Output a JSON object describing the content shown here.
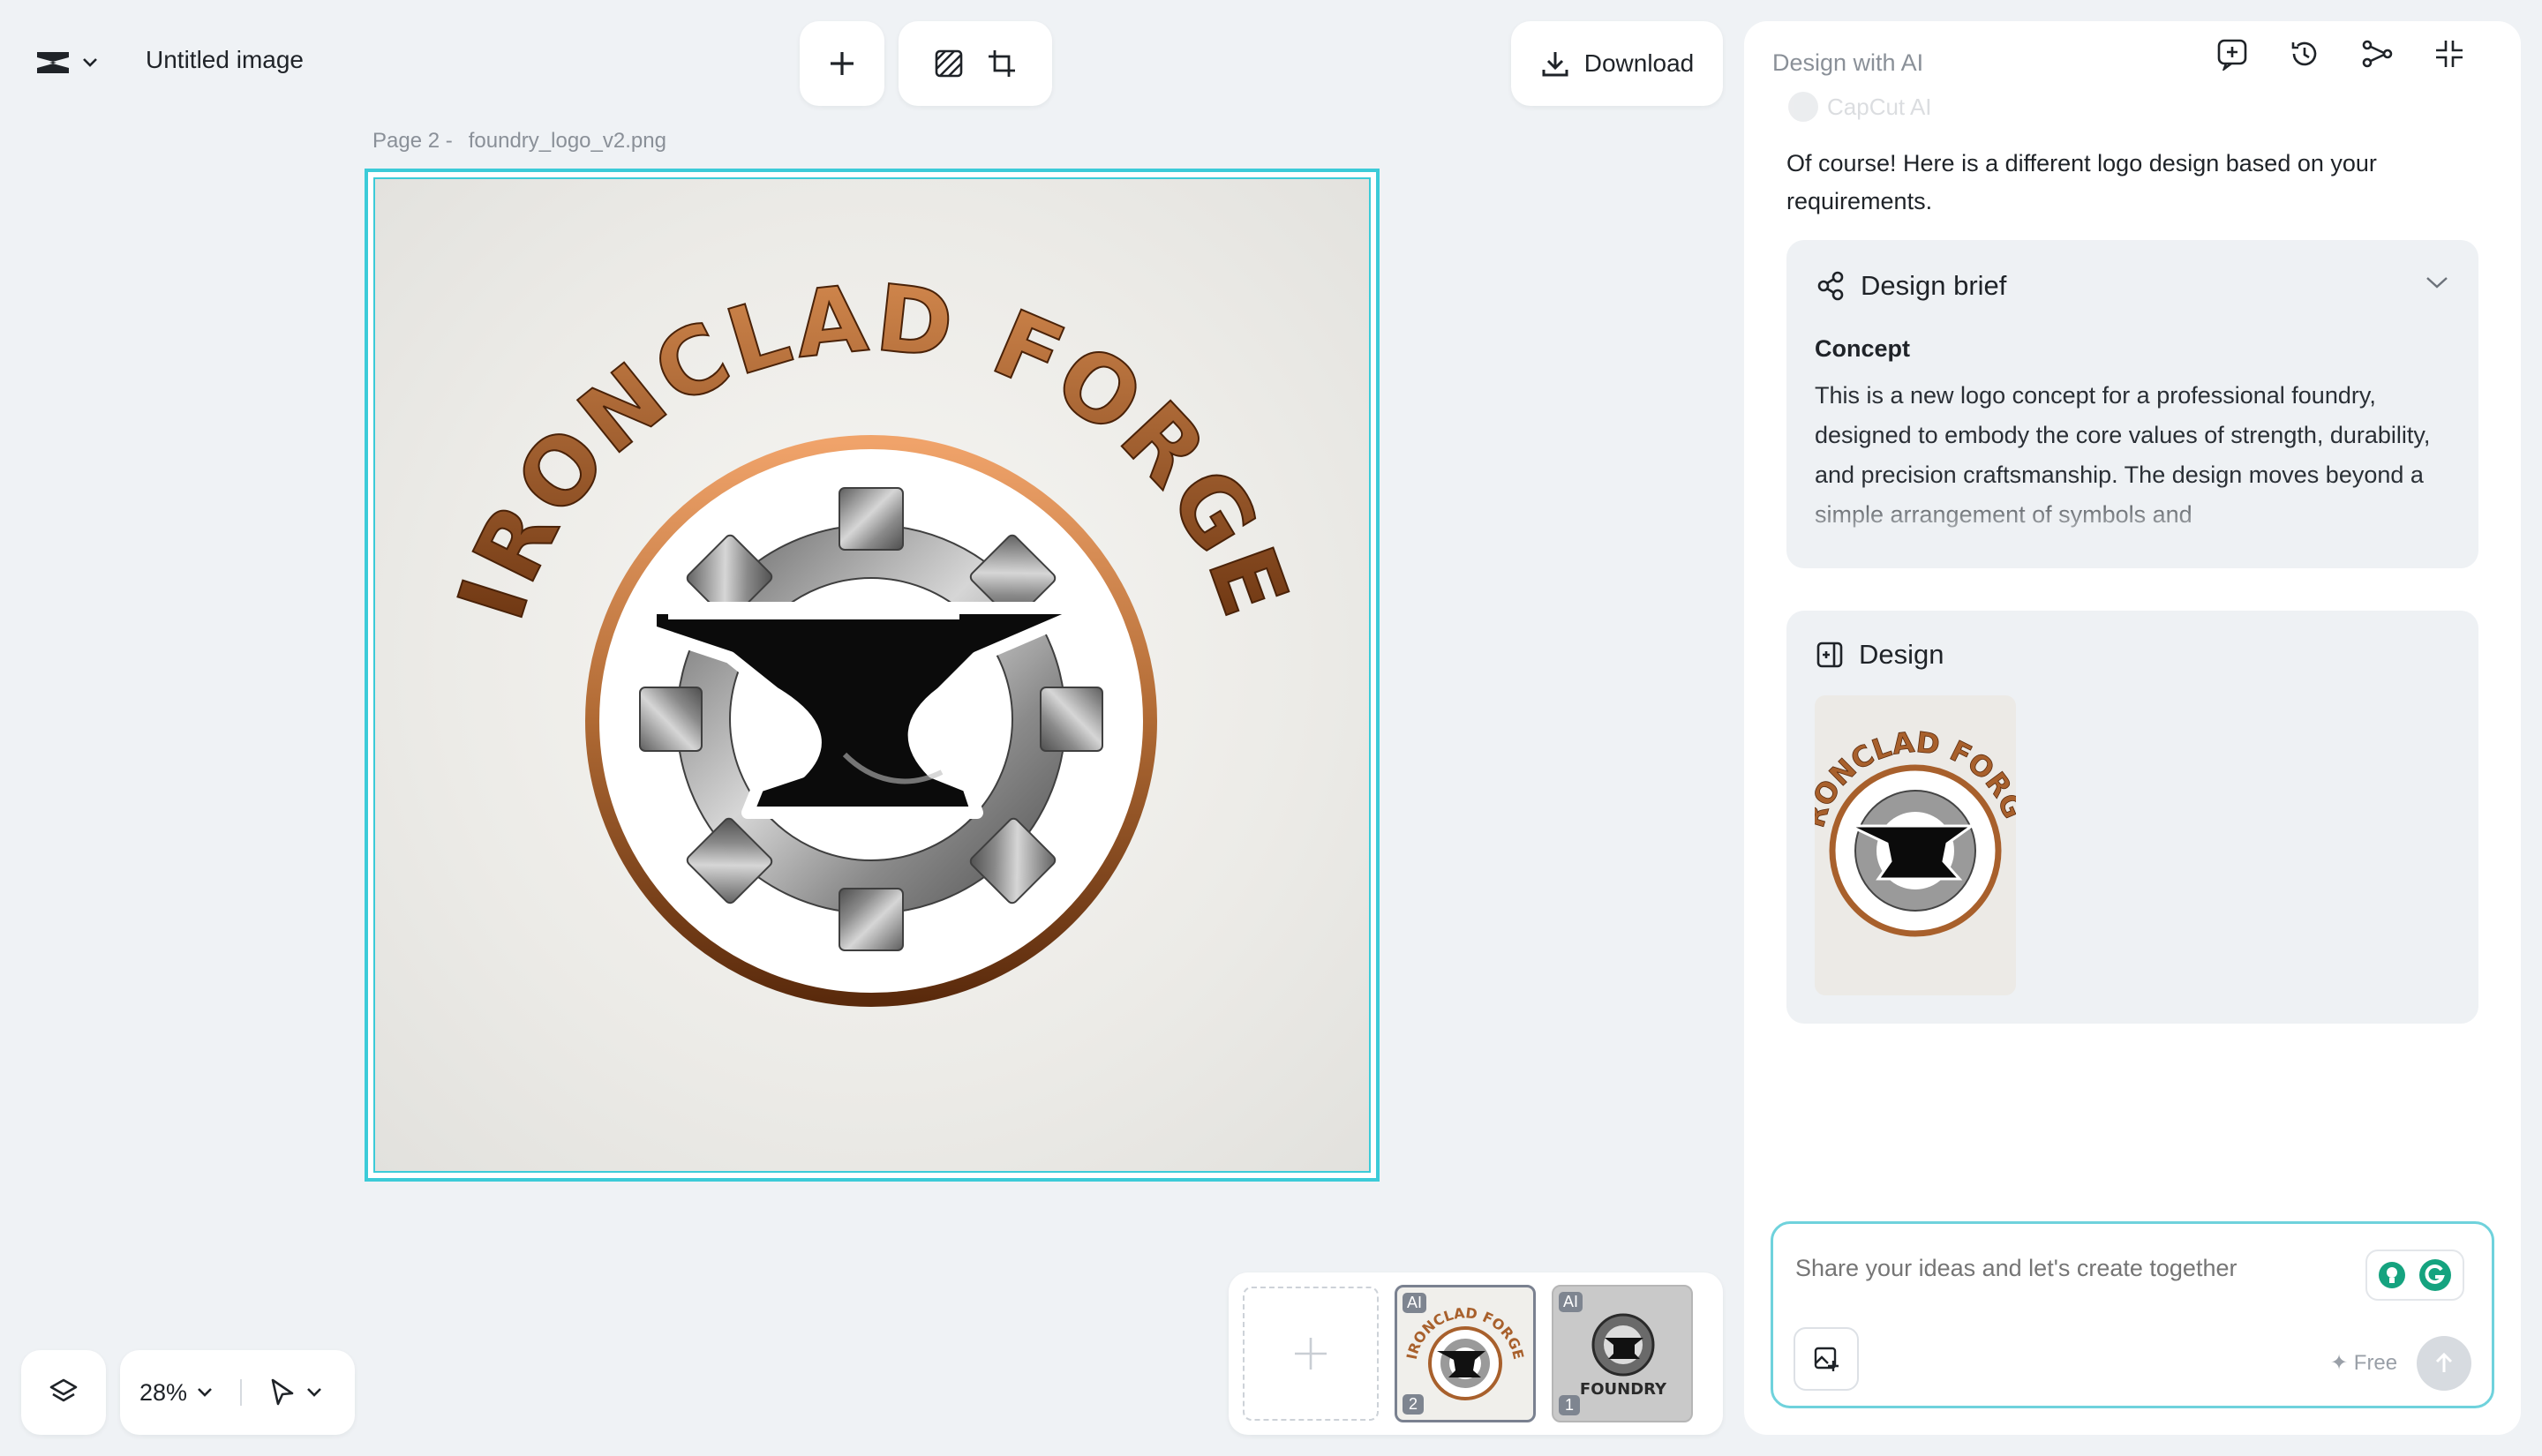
{
  "header": {
    "title": "Untitled image",
    "download_label": "Download"
  },
  "page_label": {
    "page": "Page 2 -",
    "filename": "foundry_logo_v2.png"
  },
  "canvas": {
    "logo_text": "IRONCLAD FORGE"
  },
  "bottom_bar": {
    "zoom": "28%"
  },
  "pages": [
    {
      "badge": "AI",
      "number": "2",
      "text": "IRONCLAD FORGE"
    },
    {
      "badge": "AI",
      "number": "1",
      "text": "FOUNDRY"
    }
  ],
  "panel": {
    "title": "Design with AI",
    "ai_name": "CapCut AI",
    "message": "Of course! Here is a different logo design based on your requirements.",
    "brief": {
      "title": "Design brief",
      "concept_heading": "Concept",
      "concept_text": "This is a new logo concept for a professional foundry, designed to embody the core values of strength, durability, and precision craftsmanship. The design moves beyond a simple arrangement of symbols and"
    },
    "design": {
      "title": "Design"
    },
    "input": {
      "placeholder": "Share your ideas and let's create together"
    },
    "free_label": "✦ Free"
  },
  "colors": {
    "accent": "#3ccbd8",
    "copper": "#b06a34",
    "grammarly": "#15a37f"
  }
}
